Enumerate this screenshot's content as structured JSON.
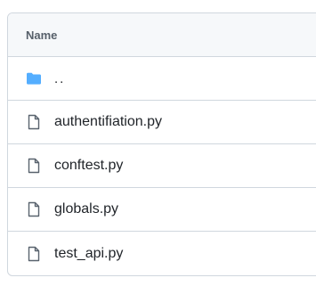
{
  "table": {
    "header": "Name"
  },
  "rows": [
    {
      "label": "..",
      "icon": "folder-icon",
      "folder_color": "#54aeff"
    },
    {
      "label": "authentifiation.py",
      "icon": "file-icon"
    },
    {
      "label": "conftest.py",
      "icon": "file-icon"
    },
    {
      "label": "globals.py",
      "icon": "file-icon"
    },
    {
      "label": "test_api.py",
      "icon": "file-icon"
    }
  ]
}
